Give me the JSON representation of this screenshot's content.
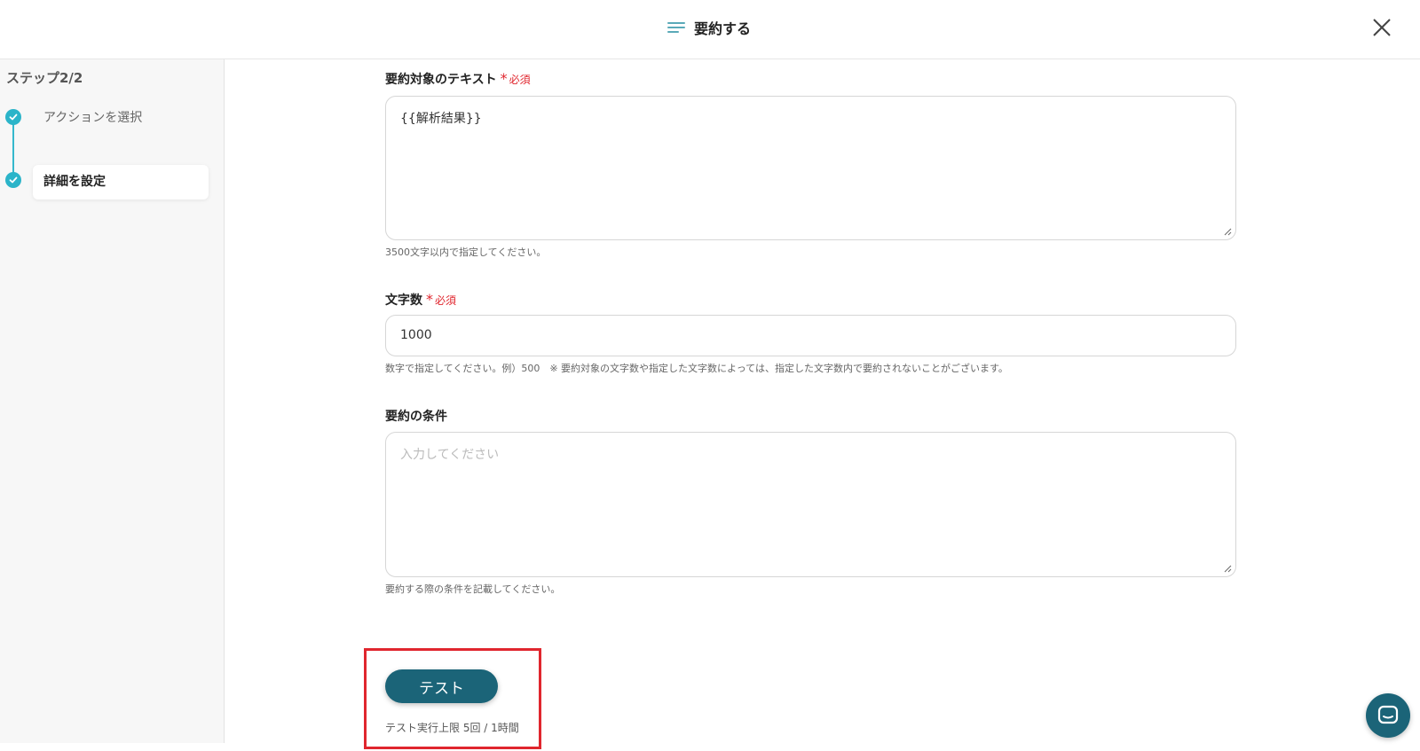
{
  "header": {
    "title": "要約する",
    "title_icon": "summary-lines-icon",
    "close_icon": "close-icon"
  },
  "sidebar": {
    "step_title": "ステップ2/2",
    "steps": [
      {
        "label": "アクションを選択",
        "status": "completed"
      },
      {
        "label": "詳細を設定",
        "status": "current"
      }
    ]
  },
  "form": {
    "required_label": "必須",
    "text_field": {
      "label": "要約対象のテキスト",
      "value": "{{解析結果}}",
      "help": "3500文字以内で指定してください。"
    },
    "char_count_field": {
      "label": "文字数",
      "value": "1000",
      "help": "数字で指定してください。例）500　※ 要約対象の文字数や指定した文字数によっては、指定した文字数内で要約されないことがございます。"
    },
    "condition_field": {
      "label": "要約の条件",
      "placeholder": "入力してください",
      "help": "要約する際の条件を記載してください。"
    }
  },
  "test": {
    "button_label": "テスト",
    "limit_text": "テスト実行上限 5回 / 1時間"
  },
  "colors": {
    "accent": "#1b6478",
    "step_teal": "#2bb4c9",
    "required_red": "#e0262e",
    "highlight_red": "#e0262e"
  }
}
